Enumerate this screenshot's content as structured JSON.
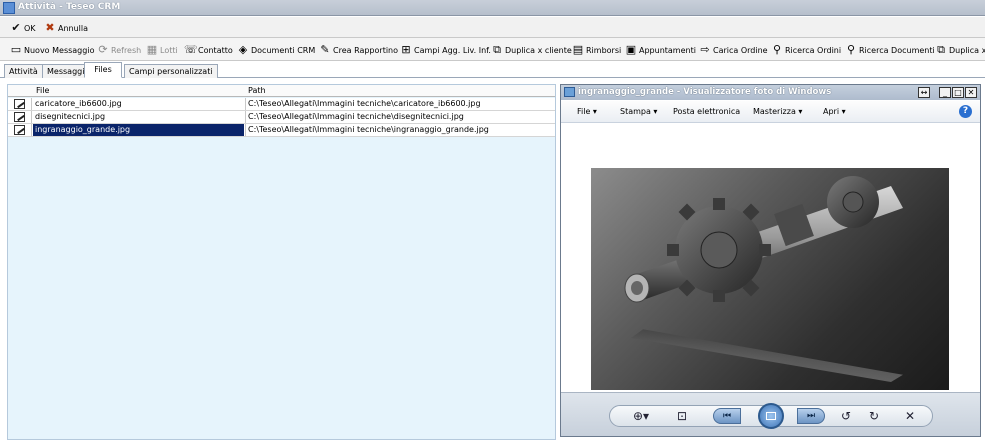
{
  "window": {
    "title": "Attività - Teseo CRM"
  },
  "toolbar1": {
    "ok_label": "OK",
    "cancel_label": "Annulla"
  },
  "toolbar2": {
    "items": [
      {
        "label": "Nuovo Messaggio",
        "icon": "new-message-icon"
      },
      {
        "label": "Refresh",
        "icon": "refresh-icon"
      },
      {
        "label": "Lotti",
        "icon": "lots-icon"
      },
      {
        "label": "Contatto",
        "icon": "contact-icon"
      },
      {
        "label": "Documenti CRM",
        "icon": "documents-icon"
      },
      {
        "label": "Crea Rapportino",
        "icon": "report-icon"
      },
      {
        "label": "Campi Agg. Liv. Inf.",
        "icon": "fields-icon"
      },
      {
        "label": "Duplica x cliente",
        "icon": "duplicate-icon"
      },
      {
        "label": "Rimborsi",
        "icon": "calculator-icon"
      },
      {
        "label": "Appuntamenti",
        "icon": "calendar-icon"
      },
      {
        "label": "Carica Ordine",
        "icon": "load-order-icon"
      },
      {
        "label": "Ricerca Ordini",
        "icon": "search-orders-icon"
      },
      {
        "label": "Ricerca Documenti",
        "icon": "search-documents-icon"
      },
      {
        "label": "Duplica x",
        "icon": "duplicate-icon"
      }
    ]
  },
  "tabs": [
    {
      "label": "Attività"
    },
    {
      "label": "Messaggi"
    },
    {
      "label": "Files",
      "active": true
    },
    {
      "label": "Campi personalizzati"
    }
  ],
  "grid": {
    "columns": [
      "File",
      "Path"
    ],
    "rows": [
      {
        "file": "caricatore_ib6600.jpg",
        "path": "C:\\Teseo\\Allegati\\Immagini tecniche\\caricatore_ib6600.jpg"
      },
      {
        "file": "disegnitecnici.jpg",
        "path": "C:\\Teseo\\Allegati\\Immagini tecniche\\disegnitecnici.jpg"
      },
      {
        "file": "ingranaggio_grande.jpg",
        "path": "C:\\Teseo\\Allegati\\Immagini tecniche\\ingranaggio_grande.jpg",
        "selected": true
      }
    ]
  },
  "viewer": {
    "title": "ingranaggio_grande - Visualizzatore foto di Windows",
    "menu": [
      "File",
      "Stampa",
      "Posta elettronica",
      "Masterizza",
      "Apri"
    ],
    "help": "?"
  },
  "colors": {
    "selection": "#0a246a",
    "grid_bg": "#e6f4fc"
  }
}
